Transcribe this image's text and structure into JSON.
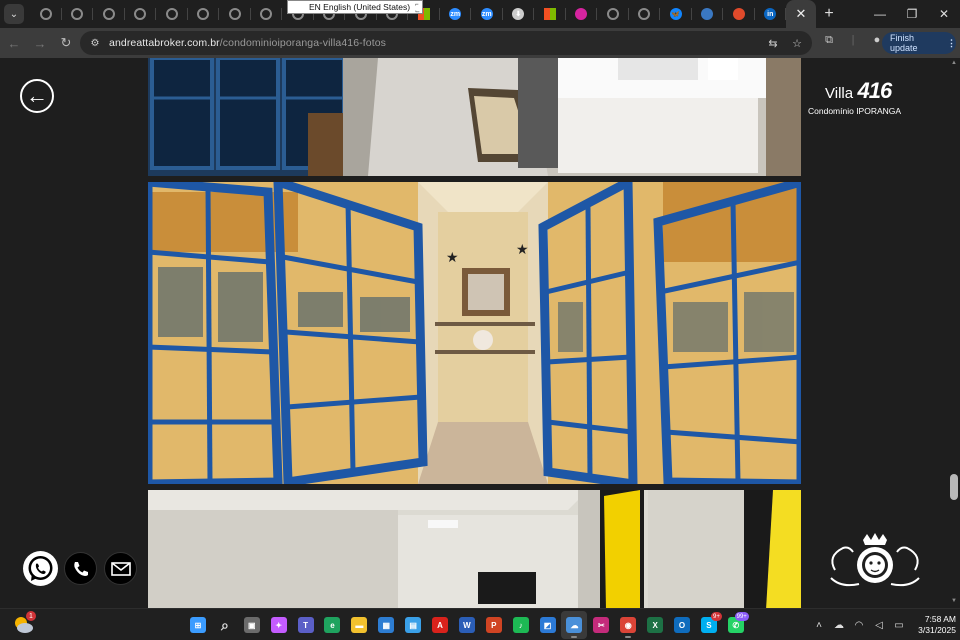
{
  "browser": {
    "tabs": [
      {
        "icon": "globe-icon",
        "color": "#8a8a8a"
      },
      {
        "icon": "globe-icon",
        "color": "#8a8a8a"
      },
      {
        "icon": "globe-icon",
        "color": "#8a8a8a"
      },
      {
        "icon": "globe-icon",
        "color": "#8a8a8a"
      },
      {
        "icon": "globe-icon",
        "color": "#8a8a8a"
      },
      {
        "icon": "globe-icon",
        "color": "#8a8a8a"
      },
      {
        "icon": "globe-icon",
        "color": "#8a8a8a"
      },
      {
        "icon": "globe-icon",
        "color": "#8a8a8a"
      },
      {
        "icon": "globe-icon",
        "color": "#8a8a8a"
      },
      {
        "icon": "globe-icon",
        "color": "#8a8a8a"
      },
      {
        "icon": "globe-icon",
        "color": "#8a8a8a"
      },
      {
        "icon": "globe-icon",
        "color": "#8a8a8a"
      },
      {
        "icon": "microsoft-icon",
        "color": "#f25022"
      },
      {
        "icon": "zoom-icon",
        "color": "#2d8cff",
        "glyph": "zm"
      },
      {
        "icon": "zoom-icon",
        "color": "#2d8cff",
        "glyph": "zm"
      },
      {
        "icon": "download-icon",
        "color": "#cccccc",
        "glyph": "⬇"
      },
      {
        "icon": "microsoft-icon",
        "color": "#7fba00"
      },
      {
        "icon": "instagram-icon",
        "color": "#d6249f"
      },
      {
        "icon": "search-globe-icon",
        "color": "#8a8a8a"
      },
      {
        "icon": "globe-icon",
        "color": "#8a8a8a"
      },
      {
        "icon": "butterfly-icon",
        "color": "#1185fe",
        "glyph": "🦋"
      },
      {
        "icon": "steam-icon",
        "color": "#3a78c2"
      },
      {
        "icon": "chrome-icon",
        "color": "#e04a2b"
      },
      {
        "icon": "linkedin-icon",
        "color": "#0a66c2",
        "glyph": "in"
      }
    ],
    "active_tab_close": "✕",
    "new_tab": "+",
    "language_tooltip": "EN English (United States)",
    "url_host": "andreattabroker.com.br",
    "url_path": "/condominioiporanga-villa416-fotos",
    "finish_update": "Finish update",
    "menu_dots": "⋮"
  },
  "page": {
    "logo_villa": "Villa",
    "logo_number": "416",
    "logo_subtitle": "Condomínio IPORANGA",
    "back_icon": "arrow-left-icon",
    "contacts": [
      "whatsapp-icon",
      "phone-icon",
      "mail-icon"
    ],
    "photos": [
      {
        "name": "kitchen-photo",
        "description": "kitchen"
      },
      {
        "name": "blue-windows-hallway-photo",
        "description": "hallway"
      },
      {
        "name": "living-room-photo",
        "description": "living room"
      }
    ]
  },
  "taskbar": {
    "weather_badge": "1",
    "apps": [
      {
        "name": "start",
        "color": "#3b9cff",
        "glyph": "⊞"
      },
      {
        "name": "search",
        "color": "transparent",
        "glyph": "⌕"
      },
      {
        "name": "task-view",
        "color": "#6b6b6b",
        "glyph": "▣"
      },
      {
        "name": "copilot",
        "color": "#c45cff",
        "glyph": "✦"
      },
      {
        "name": "teams",
        "color": "#5b5fc7",
        "glyph": "T"
      },
      {
        "name": "edge",
        "color": "#1fa35f",
        "glyph": "e"
      },
      {
        "name": "file-explorer",
        "color": "#f2c12e",
        "glyph": "▬"
      },
      {
        "name": "store",
        "color": "#2d7dd2",
        "glyph": "▦"
      },
      {
        "name": "calendar",
        "color": "#3aa0e8",
        "glyph": "▤"
      },
      {
        "name": "acrobat",
        "color": "#d9221c",
        "glyph": "A"
      },
      {
        "name": "word",
        "color": "#2b5eb7",
        "glyph": "W"
      },
      {
        "name": "powerpoint",
        "color": "#d04423",
        "glyph": "P"
      },
      {
        "name": "spotify",
        "color": "#1db954",
        "glyph": "♪"
      },
      {
        "name": "photos",
        "color": "#2c7ad6",
        "glyph": "◩"
      },
      {
        "name": "onedrive",
        "color": "#4a90d9",
        "glyph": "☁",
        "active": true
      },
      {
        "name": "snipping",
        "color": "#c42b7b",
        "glyph": "✂"
      },
      {
        "name": "chrome",
        "color": "#db4437",
        "glyph": "◉",
        "running": true
      },
      {
        "name": "excel",
        "color": "#1d7145",
        "glyph": "X"
      },
      {
        "name": "outlook",
        "color": "#0f6cbd",
        "glyph": "O"
      },
      {
        "name": "skype",
        "color": "#00aff0",
        "glyph": "S",
        "badge": "9+"
      },
      {
        "name": "whatsapp",
        "color": "#25d366",
        "glyph": "✆",
        "badge": "99+",
        "badge_color": "purple"
      }
    ],
    "time": "7:58 AM",
    "date": "3/31/2025"
  }
}
